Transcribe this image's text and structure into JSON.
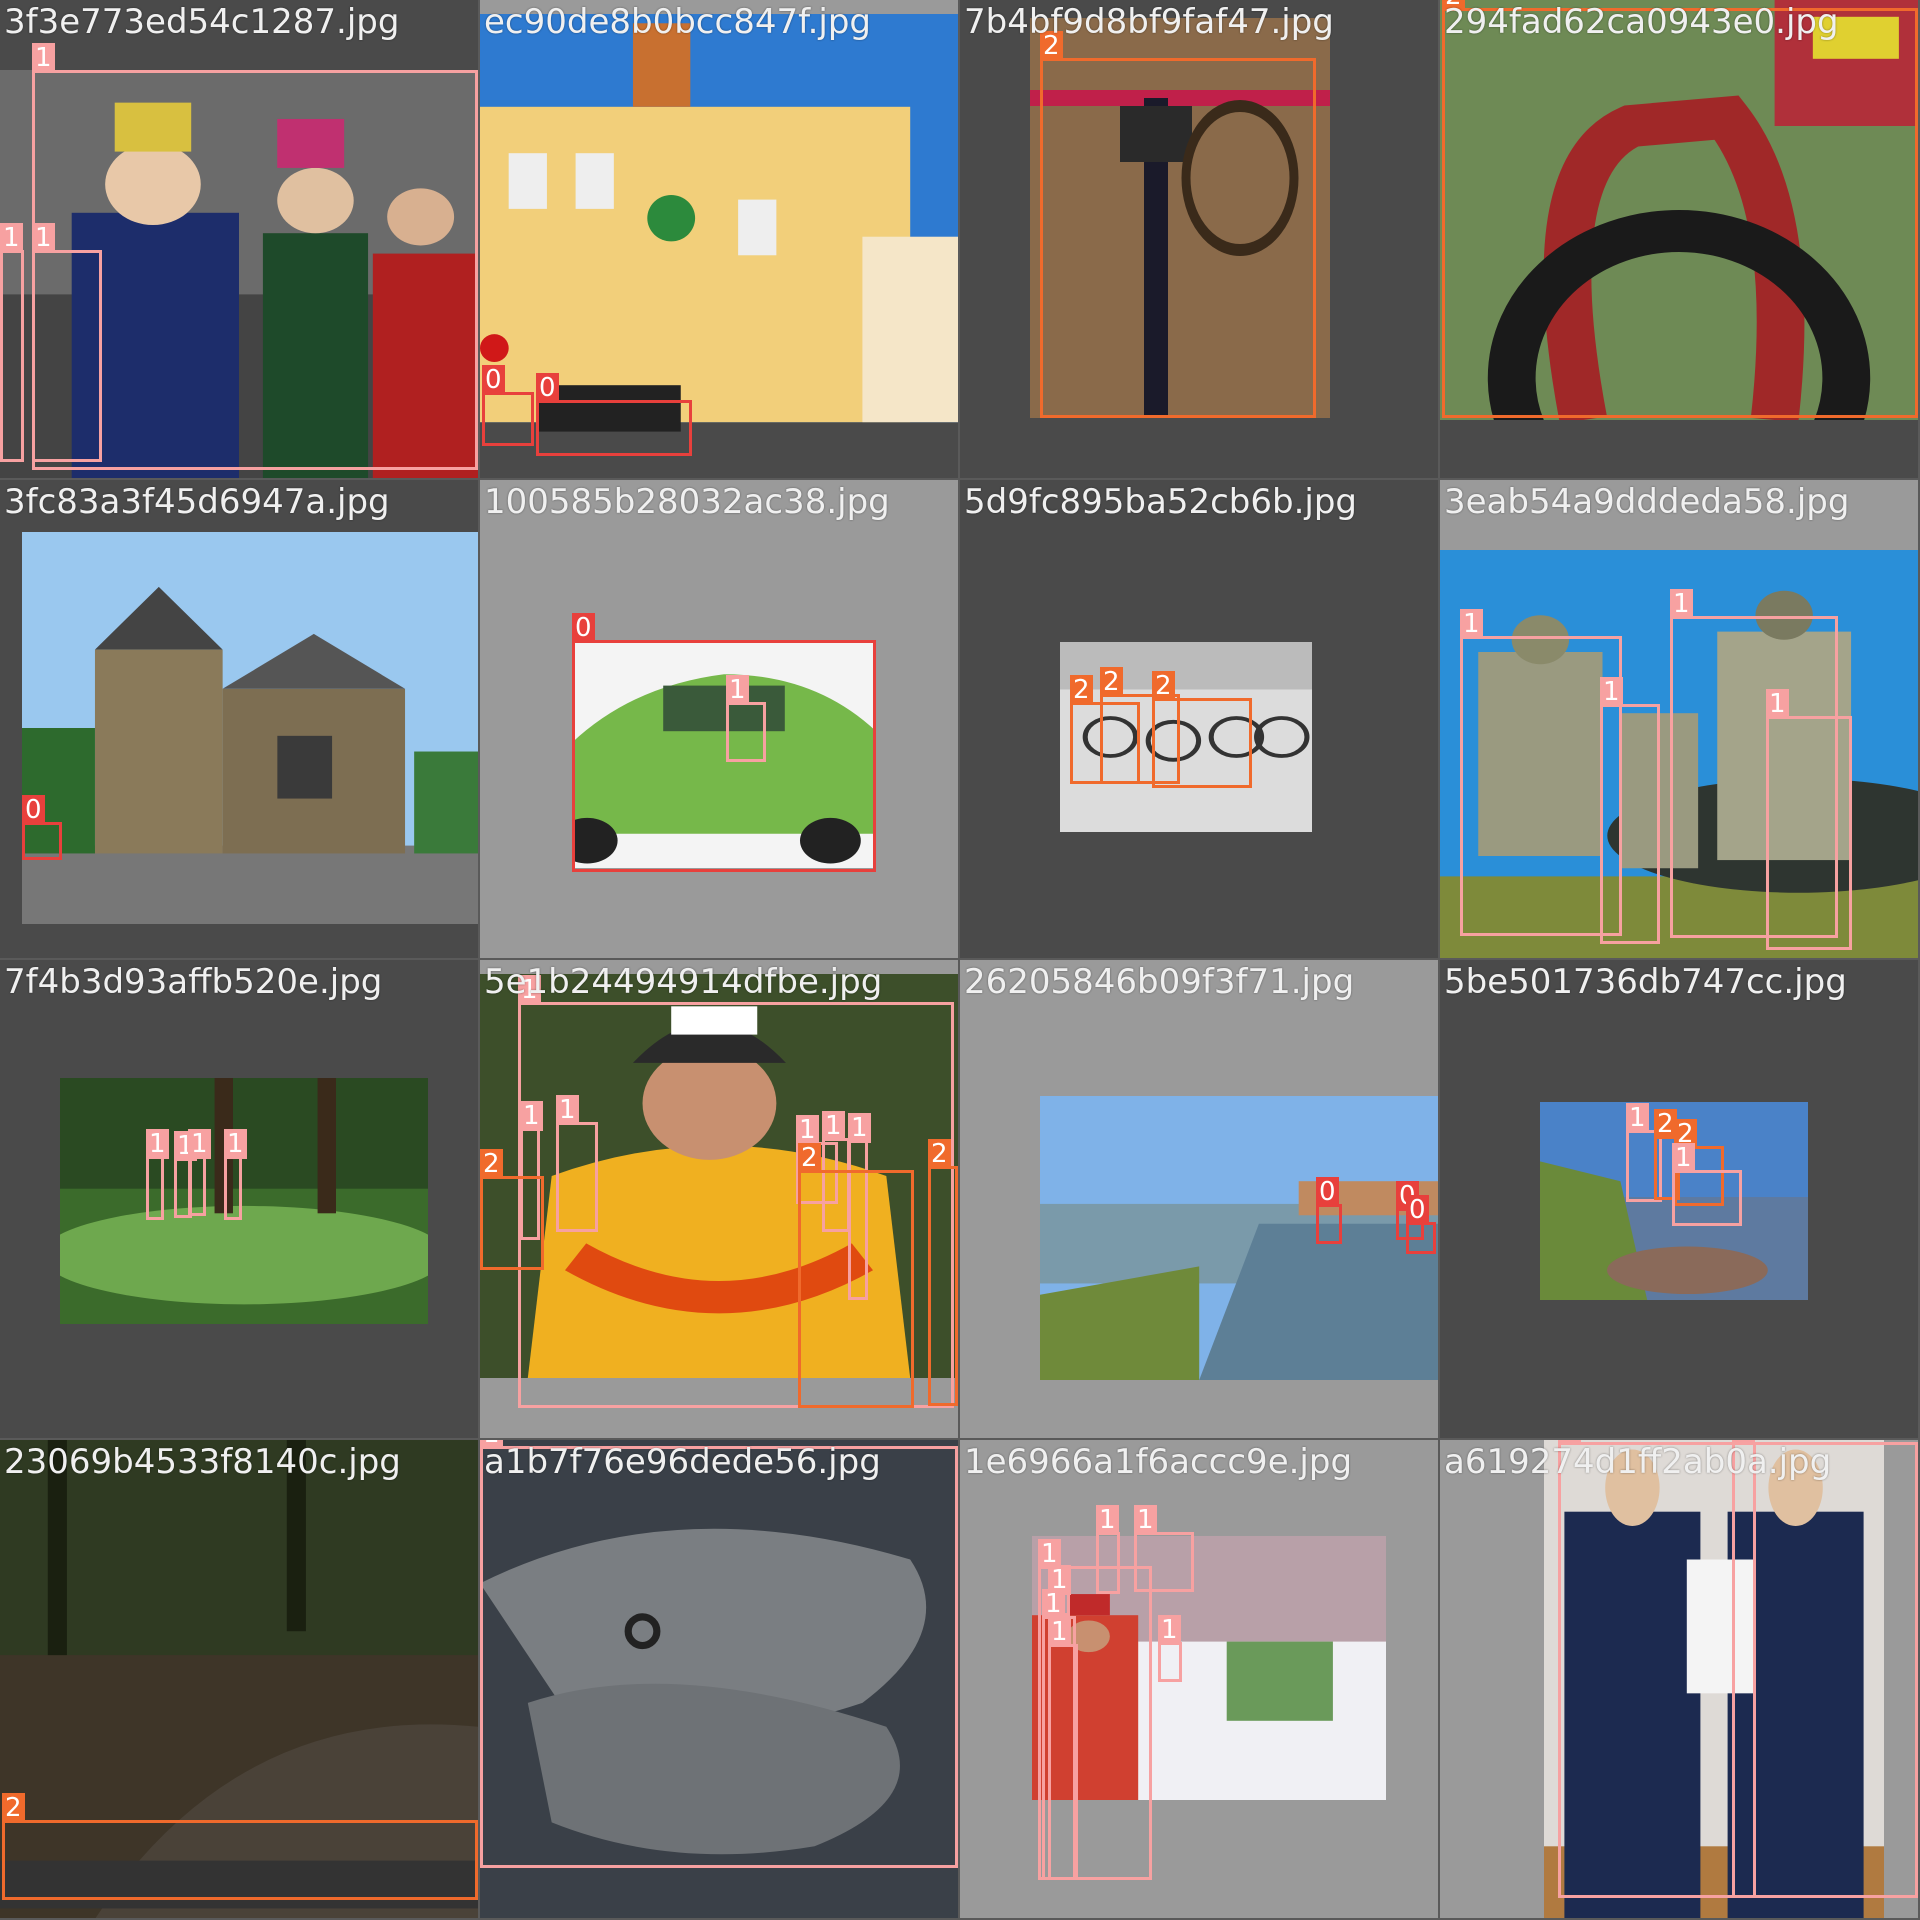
{
  "title": "",
  "colors": {
    "0": "#e8403c",
    "1": "#f7a1a1",
    "2": "#f06a2c",
    "bg_dark": "#4a4a4a",
    "bg_light": "#9a9a9a"
  },
  "tiles": [
    {
      "file": "3f3e773ed54c1287.jpg",
      "bg": "#4a4a4a",
      "scene": "festival",
      "labels": [
        "1",
        "1",
        "1"
      ]
    },
    {
      "file": "ec90de8b0bcc847f.jpg",
      "bg": "#9a9a9a",
      "scene": "pub",
      "labels": [
        "0",
        "0"
      ]
    },
    {
      "file": "7b4bf9d8bf9faf47.jpg",
      "bg": "#4a4a4a",
      "scene": "bike-top",
      "labels": [
        "2"
      ]
    },
    {
      "file": "294fad62ca0943e0.jpg",
      "bg": "#4a4a4a",
      "scene": "bike-fork",
      "labels": [
        "2"
      ]
    },
    {
      "file": "3fc83a3f45d6947a.jpg",
      "bg": "#4a4a4a",
      "scene": "church",
      "labels": [
        "0"
      ]
    },
    {
      "file": "100585b28032ac38.jpg",
      "bg": "#9a9a9a",
      "scene": "green-car",
      "labels": [
        "0",
        "1"
      ]
    },
    {
      "file": "5d9fc895ba52cb6b.jpg",
      "bg": "#4a4a4a",
      "scene": "snow-bikes",
      "labels": [
        "2",
        "2",
        "2"
      ]
    },
    {
      "file": "3eab54a9dddeda58.jpg",
      "bg": "#9a9a9a",
      "scene": "soldiers",
      "labels": [
        "1",
        "1",
        "1",
        "1"
      ]
    },
    {
      "file": "7f4b3d93affb520e.jpg",
      "bg": "#4a4a4a",
      "scene": "golf",
      "labels": [
        "1",
        "1",
        "1",
        "1"
      ]
    },
    {
      "file": "5e1b24494914dfbe.jpg",
      "bg": "#9a9a9a",
      "scene": "cyclist",
      "labels": [
        "1",
        "1",
        "1",
        "1",
        "1",
        "1",
        "2",
        "2",
        "2"
      ]
    },
    {
      "file": "26205846b09f3f71.jpg",
      "bg": "#9a9a9a",
      "scene": "harbour",
      "labels": [
        "0",
        "0",
        "0"
      ]
    },
    {
      "file": "5be501736db747cc.jpg",
      "bg": "#4a4a4a",
      "scene": "river",
      "labels": [
        "1",
        "2",
        "2",
        "1"
      ]
    },
    {
      "file": "23069b4533f8140c.jpg",
      "bg": "#4a4a4a",
      "scene": "forest",
      "labels": [
        "2"
      ]
    },
    {
      "file": "a1b7f76e96dede56.jpg",
      "bg": "#4a4a4a",
      "scene": "hands",
      "labels": [
        "1"
      ]
    },
    {
      "file": "1e6966a1f6accc9e.jpg",
      "bg": "#9a9a9a",
      "scene": "toystore",
      "labels": [
        "1",
        "1",
        "1",
        "1",
        "1",
        "1",
        "1"
      ]
    },
    {
      "file": "a619274d1ff2ab0a.jpg",
      "bg": "#9a9a9a",
      "scene": "ceremony",
      "labels": [
        "1",
        "1"
      ]
    }
  ]
}
